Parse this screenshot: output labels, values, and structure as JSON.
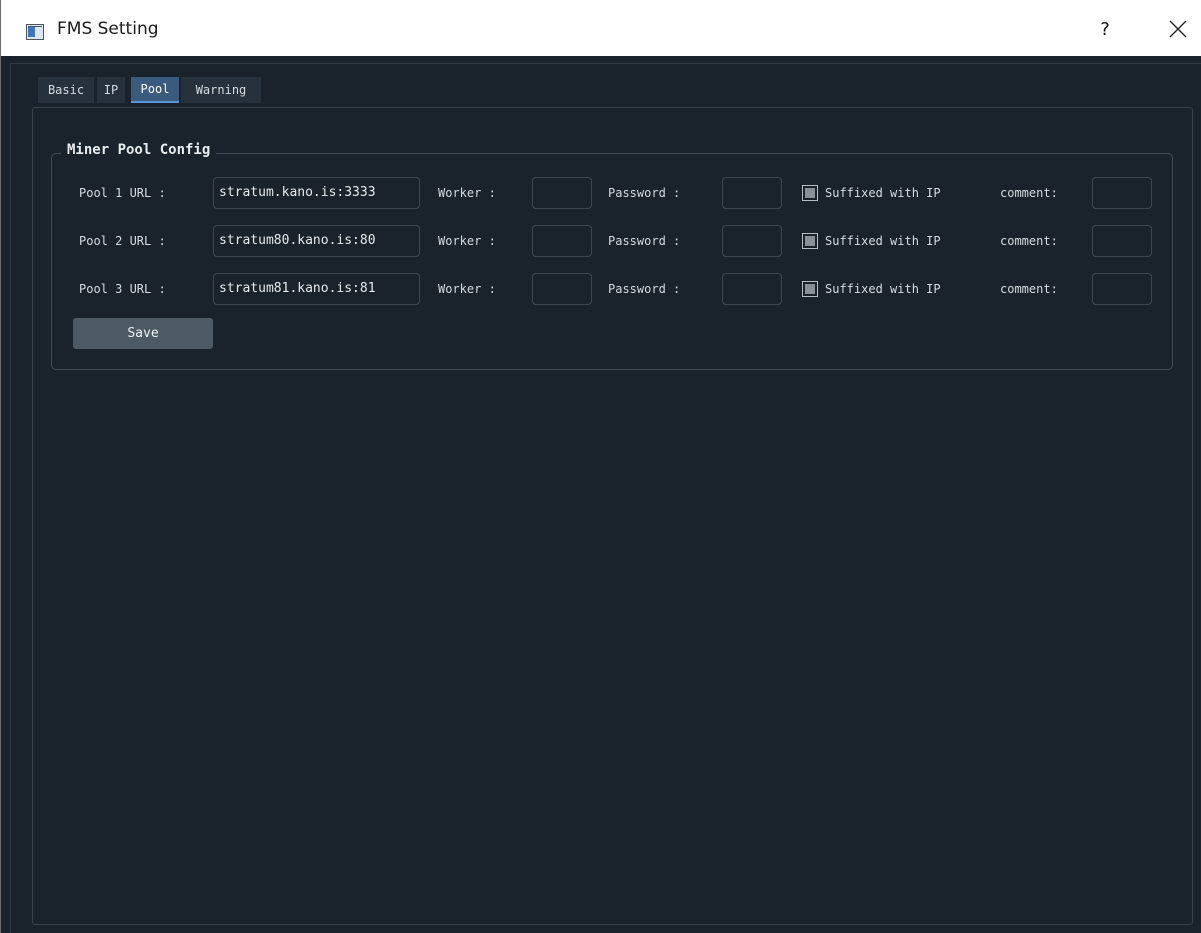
{
  "window": {
    "title": "FMS Setting",
    "help": "?",
    "close": "×"
  },
  "tabs": [
    {
      "label": "Basic"
    },
    {
      "label": "IP"
    },
    {
      "label": "Pool"
    },
    {
      "label": "Warning"
    }
  ],
  "active_tab": "Pool",
  "group": {
    "title": "Miner Pool Config"
  },
  "labels": {
    "worker": "Worker :",
    "password": "Password :",
    "suffix": "Suffixed with IP",
    "comment": "comment:"
  },
  "pools": [
    {
      "label": "Pool 1 URL :",
      "url": "stratum.kano.is:3333",
      "worker": "",
      "password": "",
      "suffixed": true,
      "comment": ""
    },
    {
      "label": "Pool 2 URL :",
      "url": "stratum80.kano.is:80",
      "worker": "",
      "password": "",
      "suffixed": true,
      "comment": ""
    },
    {
      "label": "Pool 3 URL :",
      "url": "stratum81.kano.is:81",
      "worker": "",
      "password": "",
      "suffixed": true,
      "comment": ""
    }
  ],
  "save_label": "Save"
}
